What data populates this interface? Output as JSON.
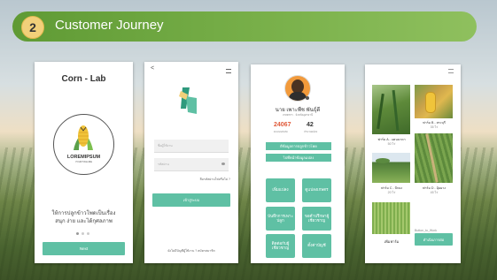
{
  "slide": {
    "step_number": "2",
    "title": "Customer Journey"
  },
  "screen1": {
    "app_title": "Corn - Lab",
    "logo_text": "LOREMIPSUM",
    "logo_tagline": "YOUR TAGLINE",
    "tagline_line1": "ให้การปลูกข้าวโพดเป็นเรื่อง",
    "tagline_line2": "สนุก ง่าย และได้กุศลภาพ",
    "next_button": "Next"
  },
  "screen2": {
    "back_icon": "<",
    "username_placeholder": "ชื่อผู้ใช้งาน",
    "password_placeholder": "รหัสผ่าน",
    "forgot_password": "ลืมรหัสผ่านใช่หรือไม่ ?",
    "login_button": "เข้าสู่ระบบ",
    "register_prompt": "ยังไม่มีบัญชีผู้ใช้งาน ? สมัครสมาชิก"
  },
  "screen3": {
    "user_name": "นาย เพาะพืช พันธุ์ดี",
    "user_subtitle": "เกษตรกร · จังหวัดอุดรธานี",
    "stat1_value": "24067",
    "stat1_label": "คะแนนสะสม",
    "stat2_value": "42",
    "stat2_label": "จำนวนแปลง",
    "wide_buttons": [
      "ดีข้อมูลการปลูกข้าวโพด",
      "ไปที่หน้าข้อมูลแปลง"
    ],
    "grid_buttons": [
      "เพิ่มแปลง",
      "ดูแปลงเกษตร",
      "บันทึกการเพาะปลูก",
      "ขอคำปรึกษาผู้เชี่ยวชาญ",
      "ติดต่อกับผู้เชี่ยวชาญ",
      "ตั้งค่าบัญชี"
    ]
  },
  "screen4": {
    "plots": [
      {
        "name": "ฟาร์ม A - แคนนาดา",
        "sub": "50 ไร่"
      },
      {
        "name": "ฟาร์ม B - สระบุรี",
        "sub": "35 ไร่"
      },
      {
        "name": "ฟาร์ม C - ปักธง",
        "sub": "20 ไร่"
      },
      {
        "name": "ฟาร์ม D - อุ้มผาง",
        "sub": "45 ไร่"
      }
    ],
    "add_plot_caption": "Button_to_Work",
    "add_plot_label": "เพิ่มฟาร์ม",
    "confirm_button": "ดำเนินการต่อ"
  },
  "colors": {
    "banner": "#79b04a",
    "badge": "#f2d07a",
    "accent": "#5fc0a4"
  }
}
